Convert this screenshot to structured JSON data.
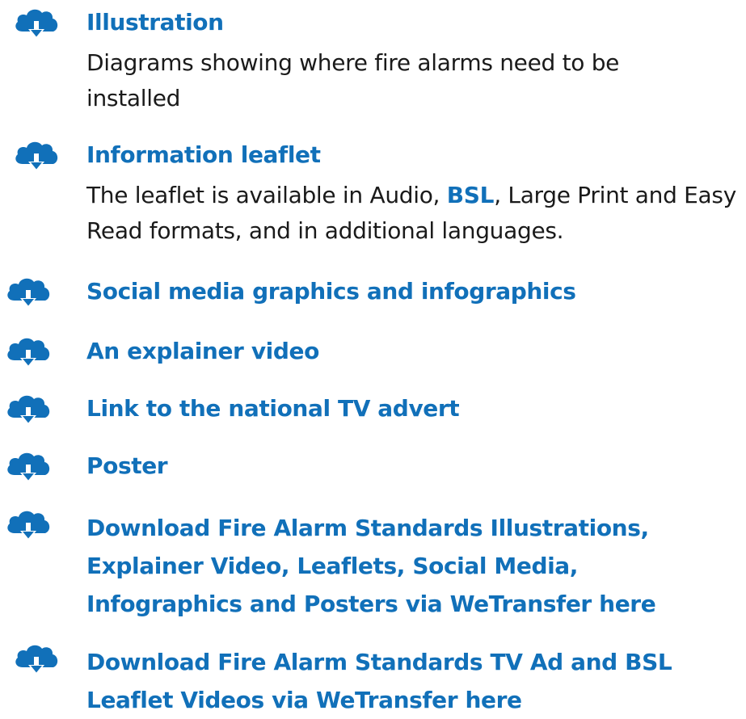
{
  "colors": {
    "accent": "#1170b9",
    "body_text": "#1a1a1a",
    "background": "#ffffff"
  },
  "icon_name": "cloud-download-icon",
  "items": [
    {
      "title": "Illustration",
      "description": "Diagrams showing where fire alarms need to be installed"
    },
    {
      "title": "Information leaflet",
      "description_before": "The leaflet is available in Audio, ",
      "description_link": "BSL",
      "description_after": ", Large Print and Easy Read formats, and in additional languages."
    },
    {
      "title": "Social media graphics and infographics"
    },
    {
      "title": "An explainer video"
    },
    {
      "title": "Link to the national TV advert"
    },
    {
      "title": "Poster"
    },
    {
      "title_lines": [
        "Download Fire Alarm Standards Illustrations,",
        "Explainer Video, Leaflets, Social Media,",
        "Infographics and Posters via WeTransfer here"
      ]
    },
    {
      "title_lines": [
        "Download Fire Alarm Standards TV Ad and BSL",
        "Leaflet Videos via WeTransfer here"
      ]
    }
  ]
}
